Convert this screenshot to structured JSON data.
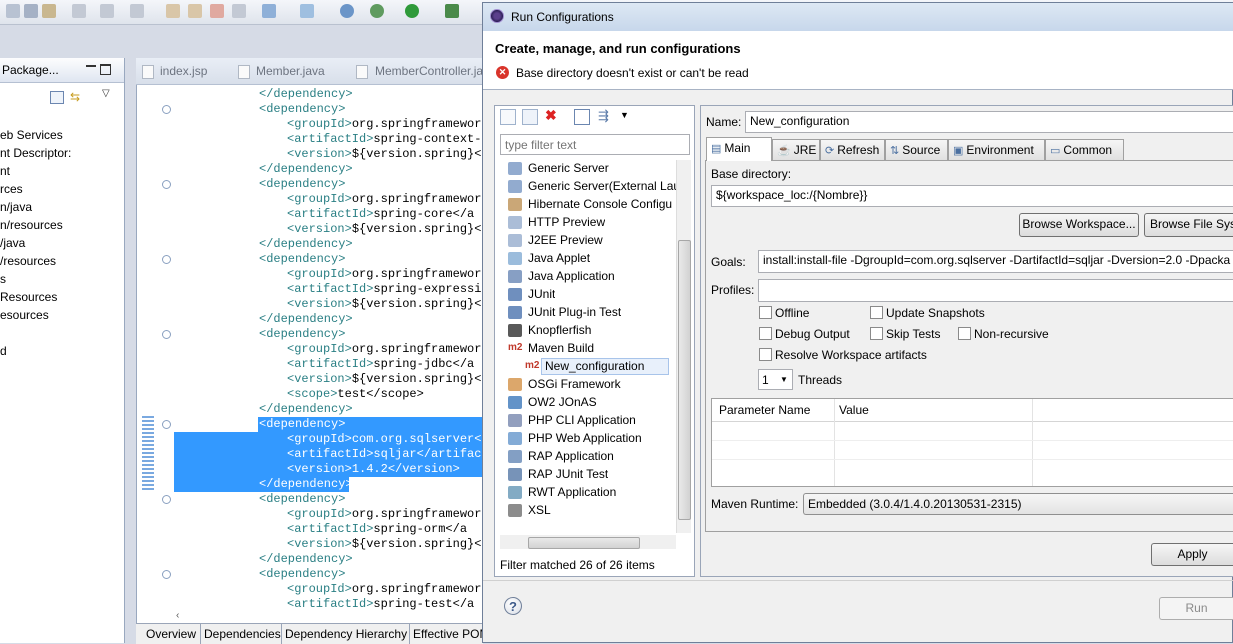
{
  "package_explorer": {
    "title": "Package...",
    "items": [
      "eb Services",
      "nt Descriptor:",
      "nt",
      "rces",
      "n/java",
      "n/resources",
      "/java",
      "/resources",
      "s",
      "Resources",
      "esources",
      "",
      "d"
    ]
  },
  "editor": {
    "tabs": [
      "index.jsp",
      "Member.java",
      "MemberController.ja"
    ],
    "lines": [
      {
        "indent": 0,
        "tag": "</dependency>",
        "value": ""
      },
      {
        "indent": 0,
        "tag": "<dependency>",
        "value": ""
      },
      {
        "indent": 1,
        "tag": "<groupId>",
        "value": "org.springframework"
      },
      {
        "indent": 1,
        "tag": "<artifactId>",
        "value": "spring-context-s"
      },
      {
        "indent": 1,
        "tag": "<version>",
        "value": "${version.spring}</"
      },
      {
        "indent": 0,
        "tag": "</dependency>",
        "value": ""
      },
      {
        "indent": 0,
        "tag": "<dependency>",
        "value": ""
      },
      {
        "indent": 1,
        "tag": "<groupId>",
        "value": "org.springframework"
      },
      {
        "indent": 1,
        "tag": "<artifactId>",
        "value": "spring-core</a"
      },
      {
        "indent": 1,
        "tag": "<version>",
        "value": "${version.spring}</"
      },
      {
        "indent": 0,
        "tag": "</dependency>",
        "value": ""
      },
      {
        "indent": 0,
        "tag": "<dependency>",
        "value": ""
      },
      {
        "indent": 1,
        "tag": "<groupId>",
        "value": "org.springframework"
      },
      {
        "indent": 1,
        "tag": "<artifactId>",
        "value": "spring-expressio"
      },
      {
        "indent": 1,
        "tag": "<version>",
        "value": "${version.spring}</"
      },
      {
        "indent": 0,
        "tag": "</dependency>",
        "value": ""
      },
      {
        "indent": 0,
        "tag": "<dependency>",
        "value": ""
      },
      {
        "indent": 1,
        "tag": "<groupId>",
        "value": "org.springframework"
      },
      {
        "indent": 1,
        "tag": "<artifactId>",
        "value": "spring-jdbc</a"
      },
      {
        "indent": 1,
        "tag": "<version>",
        "value": "${version.spring}</"
      },
      {
        "indent": 1,
        "tag": "<scope>",
        "value": "test</scope>"
      },
      {
        "indent": 0,
        "tag": "</dependency>",
        "value": ""
      },
      {
        "indent": 0,
        "tag": "<dependency>",
        "value": ""
      },
      {
        "indent": 1,
        "tag": "<groupId>",
        "value": "com.org.sqlserver</"
      },
      {
        "indent": 1,
        "tag": "<artifactId>",
        "value": "sqljar</artifact"
      },
      {
        "indent": 1,
        "tag": "<version>",
        "value": "1.4.2</version>"
      },
      {
        "indent": 0,
        "tag": "</dependency>",
        "value": ""
      },
      {
        "indent": 0,
        "tag": "<dependency>",
        "value": ""
      },
      {
        "indent": 1,
        "tag": "<groupId>",
        "value": "org.springframework"
      },
      {
        "indent": 1,
        "tag": "<artifactId>",
        "value": "spring-orm</a"
      },
      {
        "indent": 1,
        "tag": "<version>",
        "value": "${version.spring}</"
      },
      {
        "indent": 0,
        "tag": "</dependency>",
        "value": ""
      },
      {
        "indent": 0,
        "tag": "<dependency>",
        "value": ""
      },
      {
        "indent": 1,
        "tag": "<groupId>",
        "value": "org.springframework"
      },
      {
        "indent": 1,
        "tag": "<artifactId>",
        "value": "spring-test</a"
      }
    ],
    "bottom_tabs": [
      "Overview",
      "Dependencies",
      "Dependency Hierarchy",
      "Effective POM"
    ]
  },
  "dialog": {
    "title": "Run Configurations",
    "header": "Create, manage, and run configurations",
    "error": "Base directory doesn't exist or can't be read",
    "filter_placeholder": "type filter text",
    "tree_items": [
      {
        "label": "Generic Server",
        "icon": "server-icon"
      },
      {
        "label": "Generic Server(External Laun",
        "icon": "server-icon"
      },
      {
        "label": "Hibernate Console Configu",
        "icon": "hibernate-icon"
      },
      {
        "label": "HTTP Preview",
        "icon": "page-icon"
      },
      {
        "label": "J2EE Preview",
        "icon": "page-icon"
      },
      {
        "label": "Java Applet",
        "icon": "applet-icon"
      },
      {
        "label": "Java Application",
        "icon": "java-app-icon"
      },
      {
        "label": "JUnit",
        "icon": "junit-icon"
      },
      {
        "label": "JUnit Plug-in Test",
        "icon": "junit-plugin-icon"
      },
      {
        "label": "Knopflerfish",
        "icon": "knopflerfish-icon"
      },
      {
        "label": "Maven Build",
        "icon": "m2-icon"
      },
      {
        "label": "New_configuration",
        "icon": "m2-icon",
        "child": true,
        "selected": true
      },
      {
        "label": "OSGi Framework",
        "icon": "osgi-icon"
      },
      {
        "label": "OW2 JOnAS",
        "icon": "jonas-icon"
      },
      {
        "label": "PHP CLI Application",
        "icon": "php-icon"
      },
      {
        "label": "PHP Web Application",
        "icon": "php-web-icon"
      },
      {
        "label": "RAP Application",
        "icon": "rap-icon"
      },
      {
        "label": "RAP JUnit Test",
        "icon": "rap-junit-icon"
      },
      {
        "label": "RWT Application",
        "icon": "rwt-icon"
      },
      {
        "label": "XSL",
        "icon": "xsl-icon"
      }
    ],
    "filter_status": "Filter matched 26 of 26 items",
    "name_label": "Name:",
    "name_value": "New_configuration",
    "tabs": [
      "Main",
      "JRE",
      "Refresh",
      "Source",
      "Environment",
      "Common"
    ],
    "base_dir_label": "Base directory:",
    "base_dir_value": "${workspace_loc:/{Nombre}}",
    "browse_workspace": "Browse Workspace...",
    "browse_fs": "Browse File Syst",
    "goals_label": "Goals:",
    "goals_value": "install:install-file -DgroupId=com.org.sqlserver -DartifactId=sqljar -Dversion=2.0 -Dpacka",
    "profiles_label": "Profiles:",
    "profiles_value": "",
    "checkboxes": {
      "offline": "Offline",
      "update_snapshots": "Update Snapshots",
      "debug_output": "Debug Output",
      "skip_tests": "Skip Tests",
      "non_recursive": "Non-recursive",
      "resolve_workspace": "Resolve Workspace artifacts"
    },
    "threads_value": "1",
    "threads_label": "Threads",
    "param_headers": [
      "Parameter Name",
      "Value"
    ],
    "runtime_label": "Maven Runtime:",
    "runtime_value": "Embedded (3.0.4/1.4.0.20130531-2315)",
    "apply": "Apply",
    "run": "Run",
    "help": "?"
  }
}
